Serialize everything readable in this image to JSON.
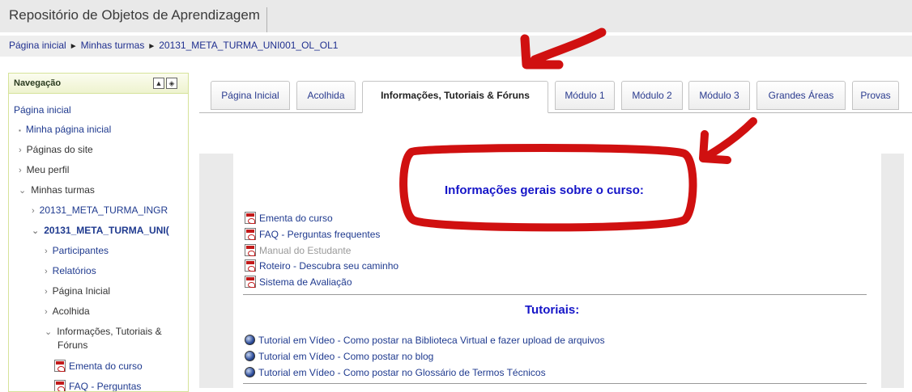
{
  "header": {
    "site_title": "Repositório de Objetos de Aprendizagem"
  },
  "breadcrumb": {
    "items": [
      "Página inicial",
      "Minhas turmas",
      "20131_META_TURMA_UNI001_OL_OL1"
    ],
    "separator": "►"
  },
  "navigation": {
    "title": "Navegação",
    "home": "Página inicial",
    "items": [
      {
        "label": "Minha página inicial",
        "marker": "▪"
      },
      {
        "label": "Páginas do site",
        "marker": "›"
      },
      {
        "label": "Meu perfil",
        "marker": "›"
      },
      {
        "label": "Minhas turmas",
        "marker": "⌄"
      },
      {
        "label": "20131_META_TURMA_INGR",
        "marker": "›"
      },
      {
        "label": "20131_META_TURMA_UNI(",
        "marker": "⌄"
      },
      {
        "label": "Participantes",
        "marker": "›"
      },
      {
        "label": "Relatórios",
        "marker": "›"
      },
      {
        "label": "Página Inicial",
        "marker": "›"
      },
      {
        "label": "Acolhida",
        "marker": "›"
      },
      {
        "label": "Informações, Tutoriais &",
        "marker": "⌄"
      },
      {
        "label": "Fóruns",
        "marker": ""
      },
      {
        "label": "Ementa do curso",
        "marker": ""
      },
      {
        "label": "FAQ - Perguntas",
        "marker": ""
      }
    ]
  },
  "tabs": [
    {
      "label": "Página Inicial"
    },
    {
      "label": "Acolhida"
    },
    {
      "label": "Informações, Tutoriais & Fóruns",
      "active": true
    },
    {
      "label": "Módulo 1"
    },
    {
      "label": "Módulo 2"
    },
    {
      "label": "Módulo 3"
    },
    {
      "label": "Grandes Áreas"
    },
    {
      "label": "Provas"
    }
  ],
  "content": {
    "info_heading": "Informações gerais sobre o curso:",
    "info_links": [
      {
        "label": "Ementa do curso"
      },
      {
        "label": "FAQ - Perguntas frequentes"
      },
      {
        "label": "Manual do Estudante",
        "dimmed": true
      },
      {
        "label": "Roteiro - Descubra seu caminho"
      },
      {
        "label": "Sistema de Avaliação"
      }
    ],
    "tutorials_heading": "Tutoriais:",
    "tutorial_links": [
      {
        "label": "Tutorial em Vídeo - Como postar na Biblioteca Virtual e fazer upload de arquivos"
      },
      {
        "label": "Tutorial em Vídeo - Como postar no blog"
      },
      {
        "label": "Tutorial em Vídeo - Como postar no Glossário de Termos Técnicos"
      }
    ]
  },
  "colors": {
    "heading_blue": "#1515c8",
    "link_blue": "#1f3a8f",
    "annotation_red": "#d01010"
  }
}
